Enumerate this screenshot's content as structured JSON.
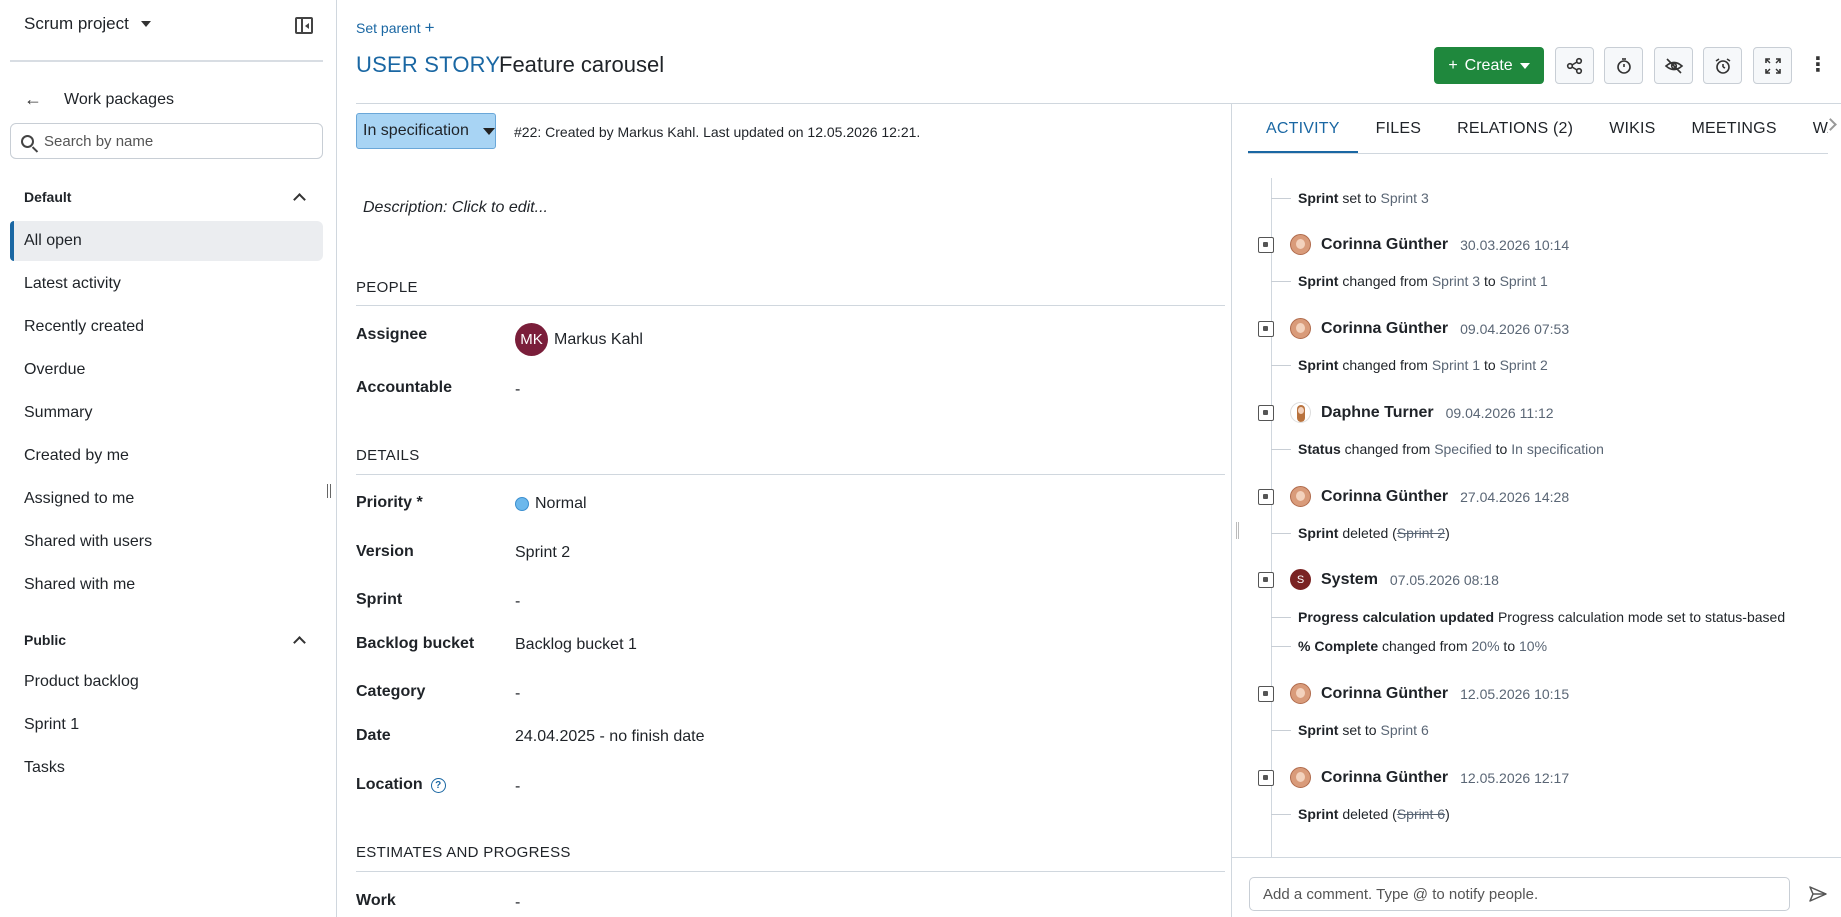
{
  "sidebar": {
    "project": "Scrum project",
    "back_label": "Work packages",
    "search_placeholder": "Search by name",
    "default_group": "Default",
    "default_items": [
      "All open",
      "Latest activity",
      "Recently created",
      "Overdue",
      "Summary",
      "Created by me",
      "Assigned to me",
      "Shared with users",
      "Shared with me"
    ],
    "public_group": "Public",
    "public_items": [
      "Product backlog",
      "Sprint 1",
      "Tasks"
    ]
  },
  "header": {
    "set_parent": "Set parent",
    "type": "USER STORY",
    "subject": "Feature carousel",
    "create_label": "Create"
  },
  "details": {
    "status": "In specification",
    "meta": "#22: Created by Markus Kahl. Last updated on 12.05.2026 12:21.",
    "description_placeholder": "Description: Click to edit...",
    "people_heading": "PEOPLE",
    "details_heading": "DETAILS",
    "estimates_heading": "ESTIMATES AND PROGRESS",
    "assignee_label": "Assignee",
    "assignee_initials": "MK",
    "assignee_name": "Markus Kahl",
    "accountable_label": "Accountable",
    "accountable_value": "-",
    "priority_label": "Priority *",
    "priority_value": "Normal",
    "version_label": "Version",
    "version_value": "Sprint 2",
    "sprint_label": "Sprint",
    "sprint_value": "-",
    "backlog_label": "Backlog bucket",
    "backlog_value": "Backlog bucket 1",
    "category_label": "Category",
    "category_value": "-",
    "date_label": "Date",
    "date_value": "24.04.2025 - no finish date",
    "location_label": "Location",
    "location_value": "-",
    "work_label": "Work",
    "work_value": "-"
  },
  "tabs": [
    "ACTIVITY",
    "FILES",
    "RELATIONS (2)",
    "WIKIS",
    "MEETINGS",
    "WATCHERS"
  ],
  "activity": {
    "first": {
      "field": "Sprint",
      "verb": " set to ",
      "to": "Sprint 3"
    },
    "entries": [
      {
        "user": "Corinna Günther",
        "time": "30.03.2026 10:14",
        "field": "Sprint",
        "text1": " changed from ",
        "from": "Sprint 3",
        "text2": " to ",
        "to": "Sprint 1"
      },
      {
        "user": "Corinna Günther",
        "time": "09.04.2026 07:53",
        "field": "Sprint",
        "text1": " changed from ",
        "from": "Sprint 1",
        "text2": " to ",
        "to": "Sprint 2"
      },
      {
        "user": "Daphne Turner",
        "time": "09.04.2026 11:12",
        "field": "Status",
        "text1": " changed from ",
        "from": "Specified",
        "text2": " to ",
        "to": "In specification"
      },
      {
        "user": "Corinna Günther",
        "time": "27.04.2026 14:28",
        "field": "Sprint",
        "text1": " deleted (",
        "struck": "Sprint 2",
        "text2": ")"
      },
      {
        "user": "System",
        "avatar_letter": "S",
        "time": "07.05.2026 08:18",
        "field": "Progress calculation updated",
        "text1": " Progress calculation mode set to status-based",
        "field2": "% Complete",
        "text3": " changed from ",
        "from": "20%",
        "text4": " to ",
        "to": "10%"
      },
      {
        "user": "Corinna Günther",
        "time": "12.05.2026 10:15",
        "field": "Sprint",
        "text1": " set to ",
        "to": "Sprint 6"
      },
      {
        "user": "Corinna Günther",
        "time": "12.05.2026 12:17",
        "field": "Sprint",
        "text1": " deleted (",
        "struck": "Sprint 6",
        "text2": ")"
      }
    ]
  },
  "comment": {
    "placeholder": "Add a comment. Type @ to notify people."
  },
  "colors": {
    "accent": "#1a67a3",
    "create": "#1f883d",
    "status_bg": "#a8d4f4"
  }
}
